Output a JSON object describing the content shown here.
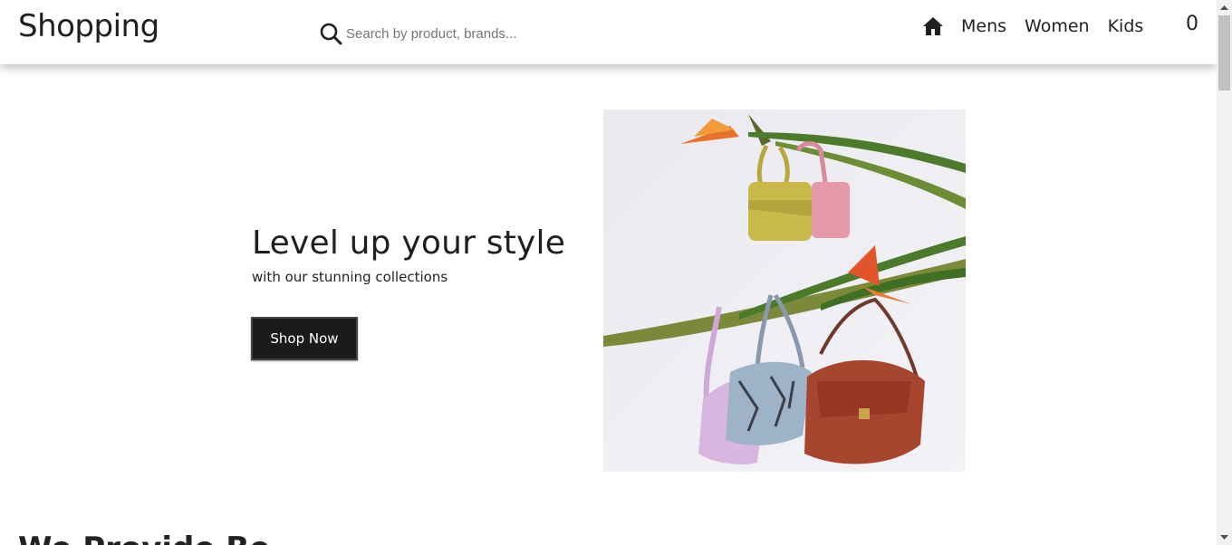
{
  "header": {
    "brand": "Shopping",
    "search": {
      "placeholder": "Search by product, brands..."
    },
    "icons": {
      "search": "search-icon",
      "home": "home-icon"
    },
    "nav": {
      "mens": "Mens",
      "women": "Women",
      "kids": "Kids"
    },
    "cart_count": "0"
  },
  "hero": {
    "title": "Level up your style",
    "subtitle": "with our stunning collections",
    "button_label": "Shop Now",
    "image": "handbags-hanging-on-branches"
  },
  "section": {
    "heading": "We Provide Be"
  },
  "colors": {
    "button_bg": "#1b1b1b",
    "text": "#222222",
    "image_bg": "#eeeef3"
  }
}
